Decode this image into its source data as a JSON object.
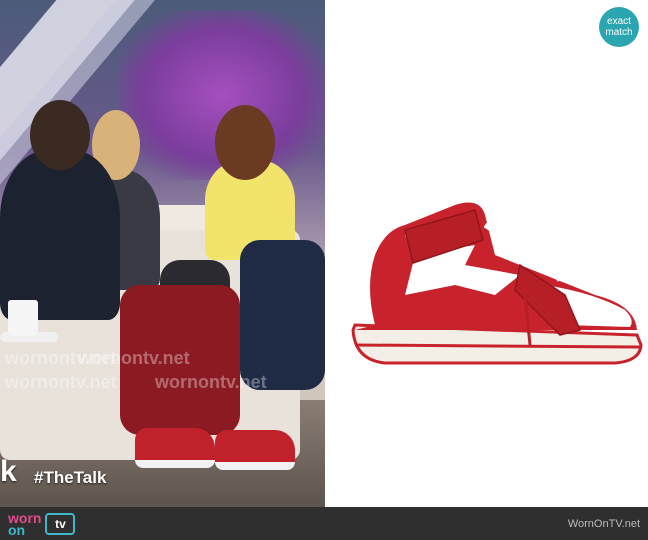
{
  "tv_still": {
    "hashtag": "#TheTalk",
    "logo": "k",
    "watermarks": [
      "wornontv.net",
      "wornontv.net",
      "wornontv.net",
      "wornontv.net"
    ]
  },
  "product": {
    "badge": {
      "line1": "exact",
      "line2": "match"
    },
    "image_icon": "sneaker-icon",
    "colors": {
      "primary": "#c8232c",
      "secondary": "#ffffff"
    }
  },
  "footer": {
    "brand_worn": "worn",
    "brand_on": "on",
    "brand_tv": "tv",
    "site": "WornOnTV.net"
  },
  "colors": {
    "accent": "#2ba6b0",
    "bar": "#2f2f2f",
    "brand_pink": "#e24b8a",
    "brand_teal": "#3db7c9"
  }
}
